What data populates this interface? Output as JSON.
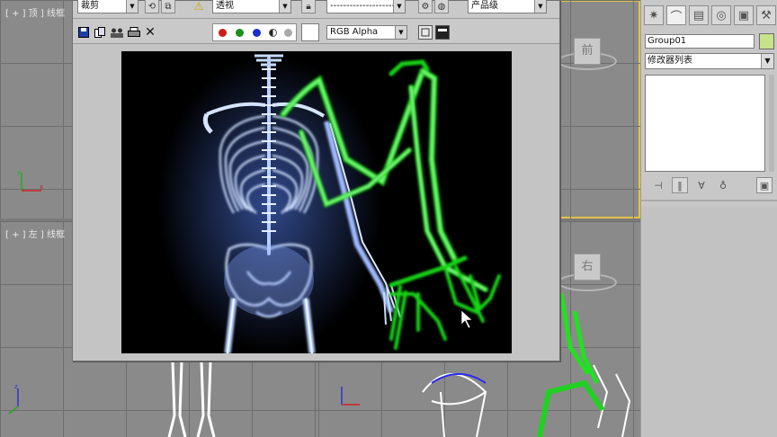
{
  "viewports": {
    "top": {
      "label": "[ + ] 顶 ] 线框"
    },
    "left": {
      "label": "[ + ] 左 ] 线框"
    },
    "front": {
      "cube_label": "前"
    },
    "right": {
      "cube_label": "右"
    }
  },
  "render_window": {
    "area_dropdown": "裁剪",
    "viewport_dropdown": "透视",
    "preset_dropdown": "----------------------",
    "quality_dropdown": "产品级",
    "channel_dropdown": "RGB Alpha",
    "icons": {
      "save": "save-icon",
      "copy": "copy-icon",
      "clone": "clone-icon",
      "print": "print-icon",
      "clear": "close-icon"
    },
    "colors": {
      "red_channel": "#d01818",
      "green_channel": "#1a8f1a",
      "blue_channel": "#1a2fd0"
    }
  },
  "command_panel": {
    "object_name": "Group01",
    "object_color": "#c6e28a",
    "modifier_list": "修改器列表"
  }
}
